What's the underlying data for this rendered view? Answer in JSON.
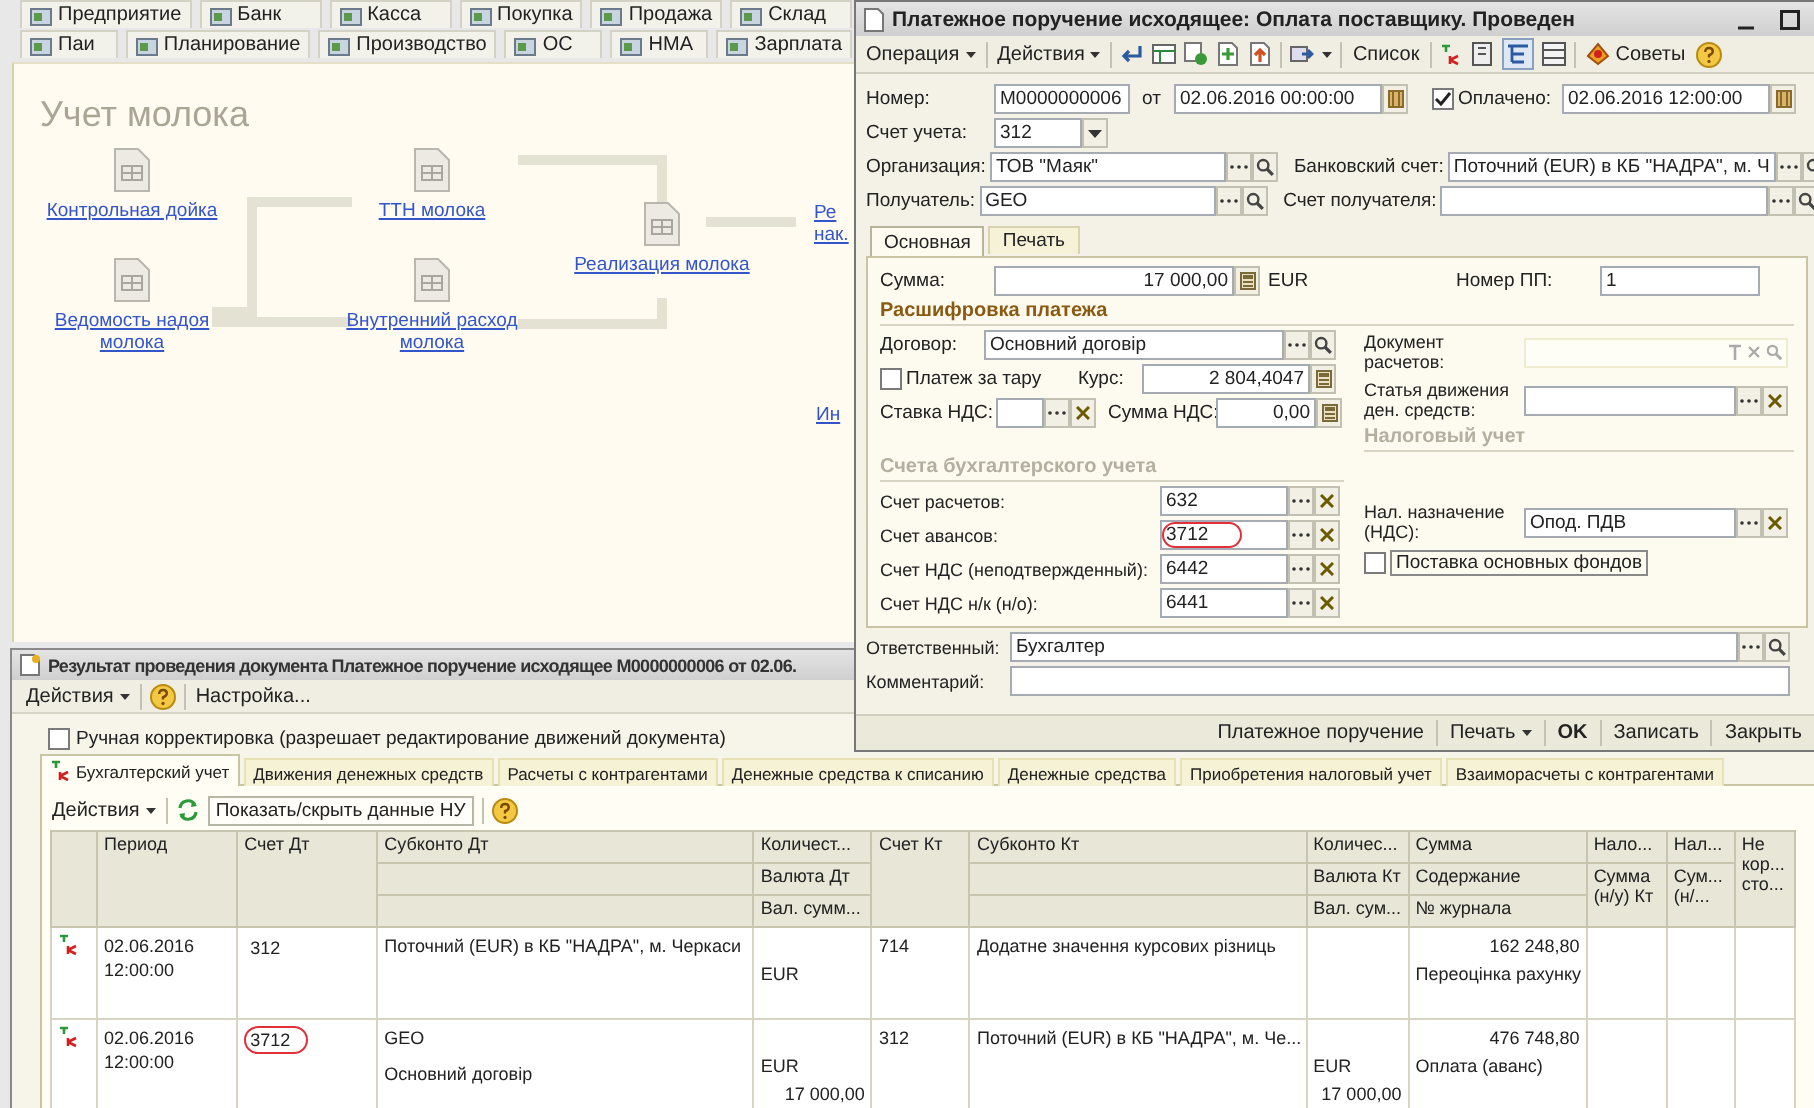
{
  "app": {
    "nav_rows": [
      [
        "Предприятие",
        "Банк",
        "Касса",
        "Покупка",
        "Продажа",
        "Склад"
      ],
      [
        "Паи",
        "Планирование",
        "Производство",
        "ОС",
        "НМА",
        "Зарплата"
      ]
    ],
    "panel_title": "Учет молока",
    "diagram_nodes": [
      {
        "label": "Контрольная дойка",
        "kind": "document"
      },
      {
        "label": "Ведомость надоя молока",
        "kind": "document"
      },
      {
        "label": "ТТН молока",
        "kind": "document"
      },
      {
        "label": "Внутренний расход молока",
        "kind": "document"
      },
      {
        "label": "Реализация молока",
        "kind": "document"
      },
      {
        "label": "Ре нак.",
        "kind": "link"
      },
      {
        "label": "Ин",
        "kind": "link"
      }
    ]
  },
  "payment_order": {
    "title": "Платежное поручение исходящее: Оплата поставщику. Проведен",
    "toolbar": {
      "operation": "Операция",
      "actions": "Действия",
      "list": "Список",
      "tips": "Советы"
    },
    "number": {
      "label": "Номер:",
      "value": "M0000000006"
    },
    "date": {
      "label": "от",
      "value": "02.06.2016 00:00:00",
      "kind": "date"
    },
    "paid": {
      "label": "Оплачено:",
      "checked": true,
      "value": "02.06.2016 12:00:00",
      "kind": "date"
    },
    "account": {
      "label": "Счет учета:",
      "value": "312",
      "kind": "select"
    },
    "organization": {
      "label": "Организация:",
      "value": "ТОВ \"Маяк\"",
      "kind": "lookup"
    },
    "bank_account": {
      "label": "Банковский счет:",
      "value": "Поточний (EUR) в КБ \"НАДРА\", м. Ч",
      "kind": "lookup"
    },
    "recipient": {
      "label": "Получатель:",
      "value": "GEO",
      "kind": "lookup"
    },
    "recipient_account": {
      "label": "Счет получателя:",
      "kind": "lookup"
    },
    "tabs": [
      {
        "label": "Основная",
        "selected": true
      },
      {
        "label": "Печать",
        "selected": false
      }
    ],
    "amount": {
      "label": "Сумма:",
      "value": "17 000,00",
      "kind": "number",
      "currency": "EUR"
    },
    "order_number": {
      "label": "Номер ПП:",
      "value": "1"
    },
    "payment_section": "Расшифровка платежа",
    "contract": {
      "label": "Договор:",
      "value": "Основний договір",
      "kind": "lookup"
    },
    "settlement_document": {
      "label": "Документ расчетов:",
      "kind": "composite"
    },
    "container_payment": {
      "label": "Платеж за тару",
      "checked": false
    },
    "rate": {
      "label": "Курс:",
      "value": "2 804,4047",
      "kind": "number"
    },
    "vat_rate": {
      "label": "Ставка НДС:",
      "kind": "clearable"
    },
    "vat_amount": {
      "label": "Сумма НДС:",
      "value": "0,00",
      "kind": "number"
    },
    "cash_flow_item": {
      "label": "Статья движения ден. средств:",
      "kind": "clearable"
    },
    "tax_section": "Налоговый учет",
    "accounts_section": "Счета бухгалтерского учета",
    "accounts": [
      {
        "label": "Счет расчетов:",
        "value": "632",
        "kind": "clearable",
        "highlighted": false
      },
      {
        "label": "Счет авансов:",
        "value": "3712",
        "kind": "clearable",
        "highlighted": true
      },
      {
        "label": "Счет НДС (неподтвержденный):",
        "value": "6442",
        "kind": "clearable",
        "highlighted": false
      },
      {
        "label": "Счет НДС н/к (н/о):",
        "value": "6441",
        "kind": "clearable",
        "highlighted": false
      }
    ],
    "tax_purpose": {
      "label": "Нал. назначение (НДС):",
      "value": "Опод. ПДВ",
      "kind": "clearable"
    },
    "fixed_assets": {
      "label": "Поставка основных фондов",
      "checked": false
    },
    "responsible": {
      "label": "Ответственный:",
      "value": "Бухгалтер",
      "kind": "lookup"
    },
    "comment": {
      "label": "Комментарий:"
    },
    "footer": [
      {
        "label": "Платежное поручение",
        "kind": "plain"
      },
      {
        "label": "Печать",
        "kind": "menu"
      },
      {
        "label": "OK",
        "kind": "default"
      },
      {
        "label": "Записать",
        "kind": "plain"
      },
      {
        "label": "Закрыть",
        "kind": "plain"
      }
    ]
  },
  "posting_result": {
    "title": "Результат проведения документа Платежное поручение исходящее M0000000006 от 02.06.",
    "toolbar": {
      "actions": "Действия",
      "settings": "Настройка..."
    },
    "manual_edit": {
      "label": "Ручная корректировка (разрешает редактирование движений документа)",
      "checked": false
    },
    "tabs": [
      {
        "label": "Бухгалтерский учет",
        "selected": true
      },
      {
        "label": "Движения денежных средств",
        "selected": false
      },
      {
        "label": "Расчеты с контрагентами",
        "selected": false
      },
      {
        "label": "Денежные средства к списанию",
        "selected": false
      },
      {
        "label": "Денежные средства",
        "selected": false
      },
      {
        "label": "Приобретения налоговый учет",
        "selected": false
      },
      {
        "label": "Взаиморасчеты с контрагентами",
        "selected": false
      }
    ],
    "table_toolbar": {
      "actions": "Действия",
      "toggle_tax": "Показать/скрыть данные НУ"
    },
    "columns": [
      {
        "kind": "icon"
      },
      {
        "kind": "single",
        "lines": [
          "Период"
        ]
      },
      {
        "kind": "single",
        "lines": [
          "Счет Дт"
        ]
      },
      {
        "kind": "subconto",
        "lines": [
          "Субконто Дт"
        ]
      },
      {
        "kind": "stacked",
        "lines": [
          "Количест...",
          "Валюта Дт",
          "Вал. сумм..."
        ]
      },
      {
        "kind": "single",
        "lines": [
          "Счет Кт"
        ]
      },
      {
        "kind": "subconto",
        "lines": [
          "Субконто Кт"
        ]
      },
      {
        "kind": "stacked",
        "lines": [
          "Количес...",
          "Валюта Кт",
          "Вал. сум..."
        ]
      },
      {
        "kind": "stacked",
        "lines": [
          "Сумма",
          "Содержание",
          "№ журнала"
        ]
      },
      {
        "kind": "stacked",
        "lines": [
          "Нало...",
          "Сумма (н/у) Кт"
        ]
      },
      {
        "kind": "stacked",
        "lines": [
          "Нал...",
          "Сум... (н/..."
        ]
      },
      {
        "kind": "single",
        "lines": [
          "Не кор... сто..."
        ]
      }
    ],
    "rows": [
      {
        "period": "02.06.2016 12:00:00",
        "account_dt": "312",
        "account_dt_highlighted": false,
        "subconto_dt": [
          "Поточний (EUR) в КБ \"НАДРА\", м. Черкаси"
        ],
        "currency_dt": "EUR",
        "account_kt": "714",
        "subconto_kt": [
          "Додатне значення курсових різниць"
        ],
        "sum": "162 248,80",
        "content": "Переоцінка рахунку"
      },
      {
        "period": "02.06.2016 12:00:00",
        "account_dt": "3712",
        "account_dt_highlighted": true,
        "subconto_dt": [
          "GEO",
          "Основний договір"
        ],
        "currency_dt": "EUR",
        "amount_dt": "17 000,00",
        "account_kt": "312",
        "subconto_kt": [
          "Поточний (EUR) в КБ \"НАДРА\", м. Че..."
        ],
        "currency_kt": "EUR",
        "amount_kt": "17 000,00",
        "sum": "476 748,80",
        "content": "Оплата (аванс)"
      }
    ]
  }
}
